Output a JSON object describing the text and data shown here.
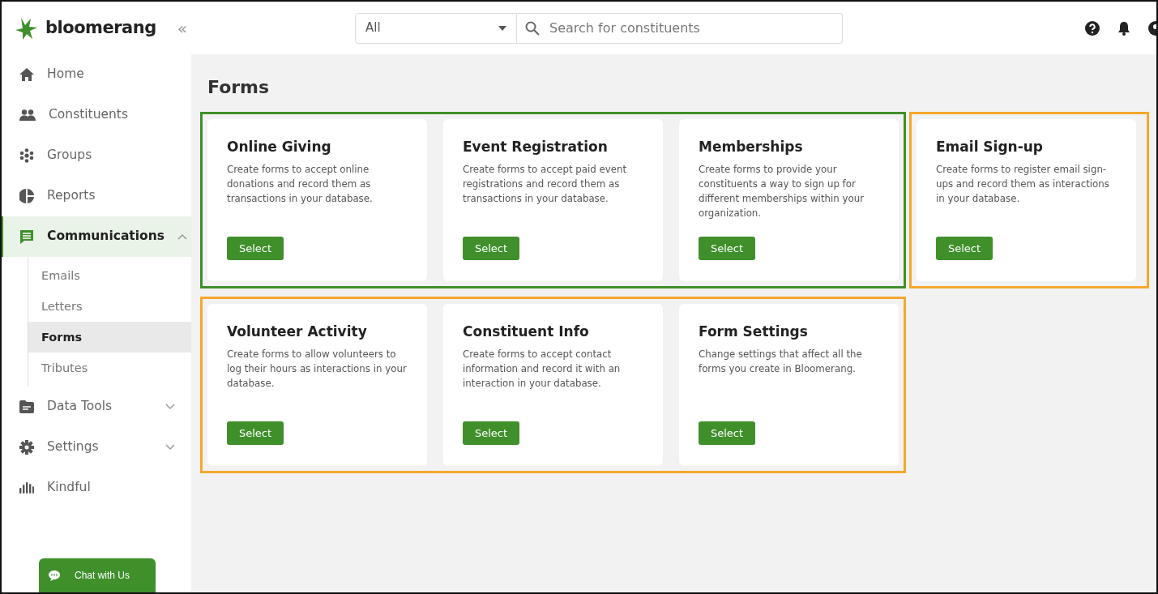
{
  "header": {
    "logo": "bloomerang",
    "collapse": "«",
    "search_scope": "All",
    "search": {
      "placeholder": "Search for constituents"
    }
  },
  "sidebar": {
    "items": [
      {
        "label": "Home",
        "kind": "link",
        "selected": false
      },
      {
        "label": "Constituents",
        "kind": "link",
        "selected": false
      },
      {
        "label": "Groups",
        "kind": "link",
        "selected": false
      },
      {
        "label": "Reports",
        "kind": "link",
        "selected": false
      },
      {
        "label": "Communications",
        "kind": "group",
        "selected": true,
        "expanded": true,
        "children": [
          {
            "label": "Emails",
            "selected": false
          },
          {
            "label": "Letters",
            "selected": false
          },
          {
            "label": "Forms",
            "selected": true
          },
          {
            "label": "Tributes",
            "selected": false
          }
        ]
      },
      {
        "label": "Data Tools",
        "kind": "group",
        "selected": false,
        "expanded": false
      },
      {
        "label": "Settings",
        "kind": "group",
        "selected": false,
        "expanded": false
      },
      {
        "label": "Kindful",
        "kind": "link",
        "selected": false
      }
    ],
    "chat": "Chat with Us"
  },
  "page": {
    "title": "Forms",
    "groups": [
      {
        "color": "#3f8f2b",
        "cards": [
          {
            "title": "Online Giving",
            "description": "Create forms to accept online donations and record them as transactions in your database.",
            "button": "Select"
          },
          {
            "title": "Event Registration",
            "description": "Create forms to accept paid event registrations and record them as transactions in your database.",
            "button": "Select"
          },
          {
            "title": "Memberships",
            "description": "Create forms to provide your constituents a way to sign up for different memberships within your organization.",
            "button": "Select"
          }
        ]
      },
      {
        "color": "#f5a82d",
        "cards": [
          {
            "title": "Email Sign-up",
            "description": "Create forms to register email sign-ups and record them as interactions in your database.",
            "button": "Select"
          }
        ]
      },
      {
        "color": "#f5a82d",
        "cards": [
          {
            "title": "Volunteer Activity",
            "description": "Create forms to allow volunteers to log their hours as interactions in your database.",
            "button": "Select"
          },
          {
            "title": "Constituent Info",
            "description": "Create forms to accept contact information and record it with an interaction in your database.",
            "button": "Select"
          },
          {
            "title": "Form Settings",
            "description": "Change settings that affect all the forms you create in Bloomerang.",
            "button": "Select"
          }
        ]
      }
    ]
  }
}
